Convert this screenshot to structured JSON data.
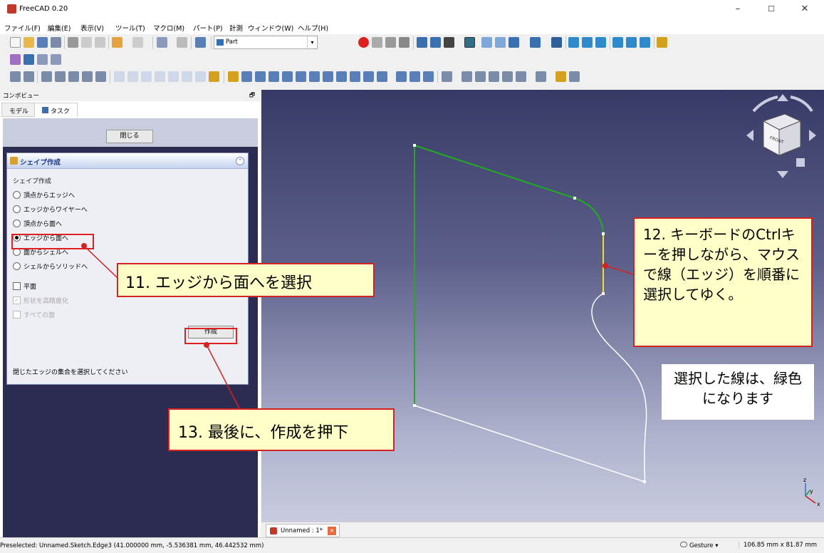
{
  "app": {
    "title": "FreeCAD 0.20",
    "minimize": "–",
    "maximize": "☐",
    "close": "✕"
  },
  "menu": [
    "ファイル(F)",
    "編集(E)",
    "表示(V)",
    "ツール(T)",
    "マクロ(M)",
    "パート(P)",
    "計測",
    "ウィンドウ(W)",
    "ヘルプ(H)"
  ],
  "workbench": {
    "selected": "Part"
  },
  "combo": {
    "title": "コンボビュー",
    "float_icon": "🗗",
    "tabs": {
      "model": "モデル",
      "task": "タスク"
    },
    "close_label": "閉じる"
  },
  "panel": {
    "title": "シェイプ作成",
    "group_label": "シェイプ作成",
    "options": [
      "頂点からエッジへ",
      "エッジからワイヤーへ",
      "頂点から面へ",
      "エッジから面へ",
      "面からシェルへ",
      "シェルからソリッドへ"
    ],
    "selected_option": "エッジから面へ",
    "planar": "平面",
    "refine": "形状を高精度化",
    "all_faces": "すべての面",
    "create_label": "作成",
    "hint": "閉じたエッジの集合を選択してください"
  },
  "view": {
    "navcube_face": "FRONT",
    "axis": {
      "z": "z",
      "y": "y",
      "x": "x"
    }
  },
  "doc_tab": {
    "label": "Unnamed : 1*",
    "close": "×"
  },
  "status": {
    "text": "Preselected: Unnamed.Sketch.Edge3 (41.000000 mm, -5.536381 mm, 46.442532 mm)",
    "nav_style": "Gesture ▾",
    "dimensions": "106.85 mm x 81.87 mm"
  },
  "annotations": {
    "step11": "11. エッジから面へを選択",
    "step12": "12. キーボードのCtrlキーを押しながら、マウスで線（エッジ）を順番に選択してゆく。",
    "step13": "13. 最後に、作成を押下",
    "note": "選択した線は、緑色になります"
  },
  "colors": {
    "selected_edge": "#22aa22",
    "preselected_edge": "#f0e020",
    "unselected_edge": "#ffffff",
    "callout_border": "#d32222",
    "callout_fill": "#ffffc8"
  }
}
